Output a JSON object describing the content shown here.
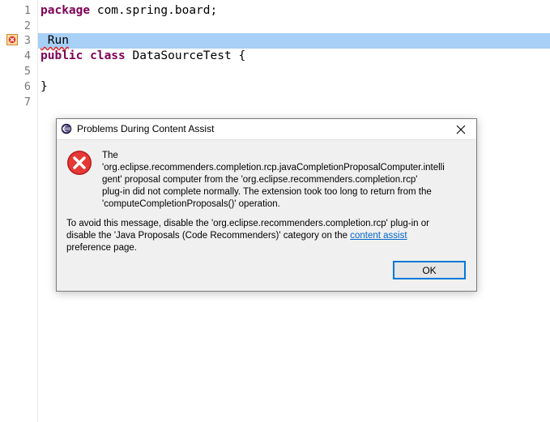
{
  "editor": {
    "lines": [
      {
        "number": "1",
        "keyword": "package",
        "text": " com.spring.board;"
      },
      {
        "number": "2",
        "keyword": "",
        "text": ""
      },
      {
        "number": "3",
        "keyword": "",
        "text": " Run"
      },
      {
        "number": "4",
        "keyword": "public class",
        "text": " DataSourceTest {"
      },
      {
        "number": "5",
        "keyword": "",
        "text": ""
      },
      {
        "number": "6",
        "keyword": "",
        "text": "}"
      },
      {
        "number": "7",
        "keyword": "",
        "text": ""
      }
    ],
    "colors": {
      "keyword": "#7f0055",
      "highlight": "#a8cff5",
      "line_number": "#787878",
      "ruler_mark": "#6fa58b"
    }
  },
  "dialog": {
    "title": "Problems During Content Assist",
    "message_line1": "The",
    "message_line2": "'org.eclipse.recommenders.completion.rcp.javaCompletionProposalComputer.intelli",
    "message_line3": "gent' proposal computer from the 'org.eclipse.recommenders.completion.rcp'",
    "message_line4": "plug-in did not complete normally. The extension took too long to return from the",
    "message_line5": "'computeCompletionProposals()' operation.",
    "advice_line1": "To avoid this message, disable the 'org.eclipse.recommenders.completion.rcp' plug-in or",
    "advice_line2_before": "disable the 'Java Proposals (Code Recommenders)' category on the ",
    "advice_link": "content assist",
    "advice_line3": "preference page.",
    "ok_label": "OK",
    "icons": {
      "title": "eclipse-icon",
      "close": "close-icon",
      "error": "error-icon"
    }
  }
}
